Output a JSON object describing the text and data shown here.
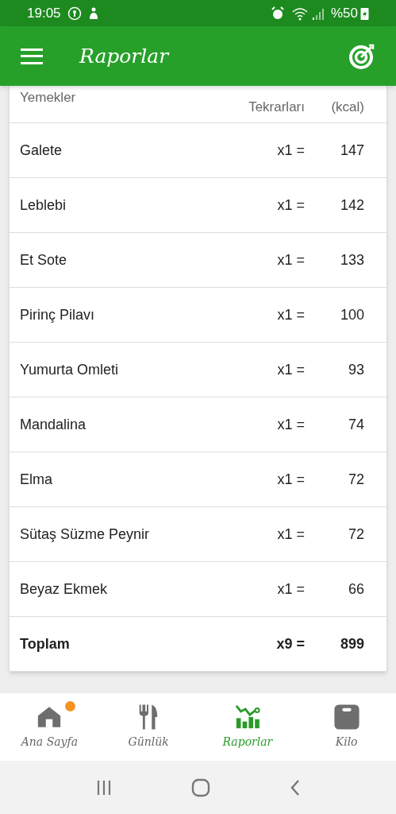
{
  "status_bar": {
    "time": "19:05",
    "battery": "%50"
  },
  "app_bar": {
    "title": "Raporlar"
  },
  "table": {
    "columns": [
      "Yemekler",
      "Tekrarları",
      "(kcal)"
    ],
    "rows": [
      {
        "name": "Galete",
        "count": "x1 =",
        "kcal": "147"
      },
      {
        "name": "Leblebi",
        "count": "x1 =",
        "kcal": "142"
      },
      {
        "name": "Et Sote",
        "count": "x1 =",
        "kcal": "133"
      },
      {
        "name": "Pirinç Pilavı",
        "count": "x1 =",
        "kcal": "100"
      },
      {
        "name": "Yumurta Omleti",
        "count": "x1 =",
        "kcal": "93"
      },
      {
        "name": "Mandalina",
        "count": "x1 =",
        "kcal": "74"
      },
      {
        "name": "Elma",
        "count": "x1 =",
        "kcal": "72"
      },
      {
        "name": "Sütaş Süzme Peynir",
        "count": "x1 =",
        "kcal": "72"
      },
      {
        "name": "Beyaz Ekmek",
        "count": "x1 =",
        "kcal": "66"
      }
    ],
    "total": {
      "name": "Toplam",
      "count": "x9 =",
      "kcal": "899"
    }
  },
  "bottom_nav": [
    {
      "kind": "home",
      "label": "Ana Sayfa",
      "selected": false,
      "badge": true
    },
    {
      "kind": "diary",
      "label": "Günlük",
      "selected": false,
      "badge": false
    },
    {
      "kind": "reports",
      "label": "Raporlar",
      "selected": true,
      "badge": false
    },
    {
      "kind": "weight",
      "label": "Kilo",
      "selected": false,
      "badge": false
    }
  ]
}
